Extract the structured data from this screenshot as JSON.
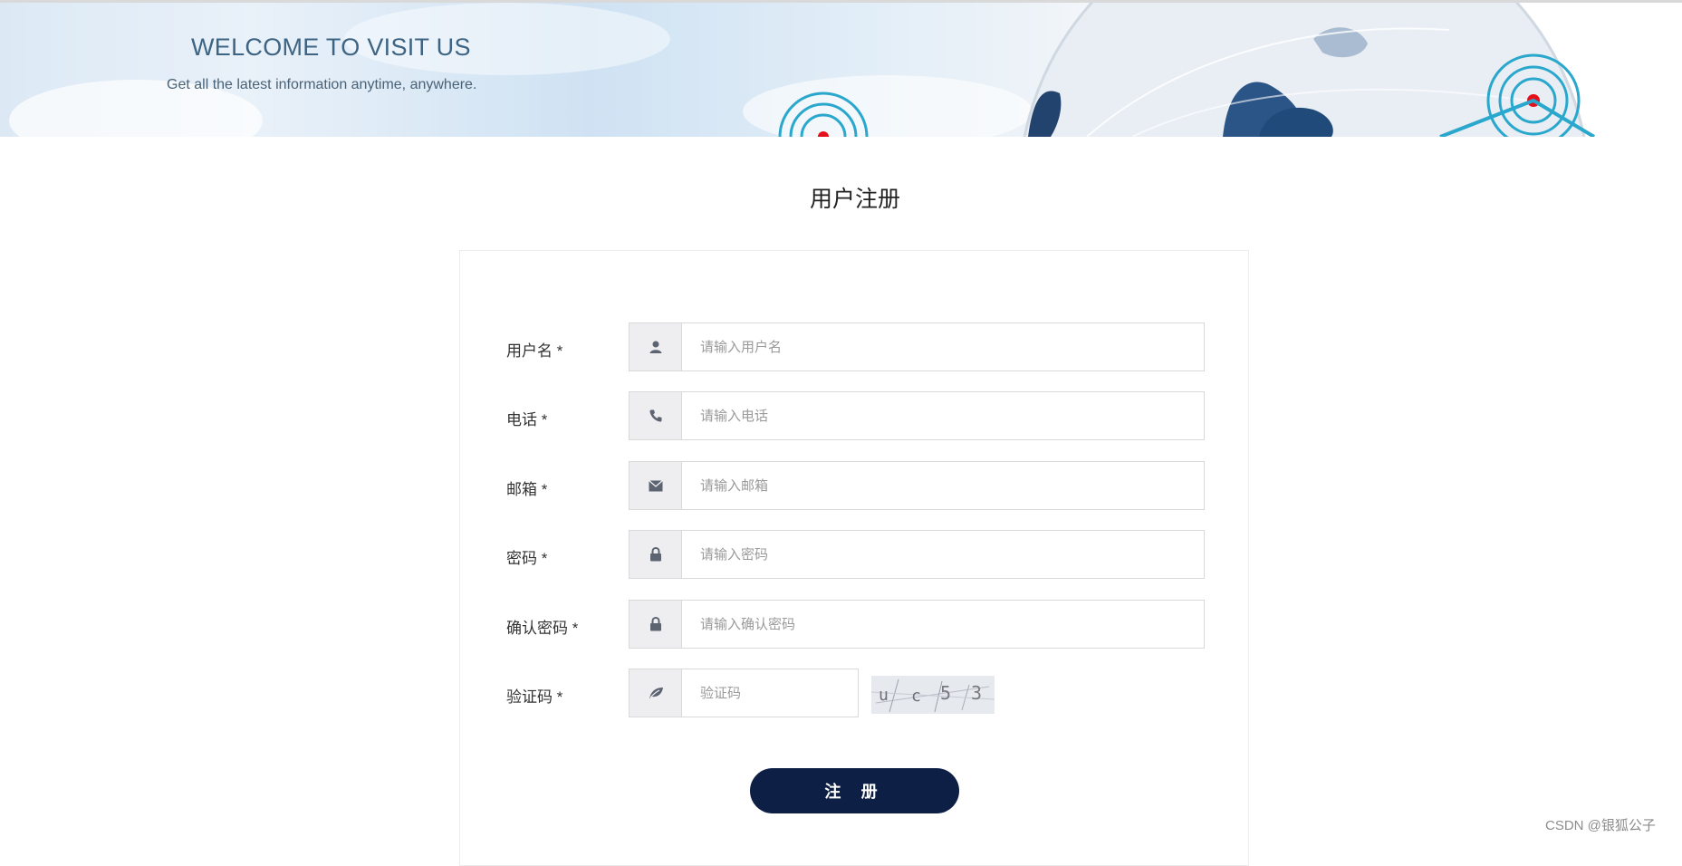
{
  "banner": {
    "title": "WELCOME TO VISIT US",
    "subtitle": "Get all the latest information anytime, anywhere."
  },
  "page_title": "用户注册",
  "form": {
    "fields": [
      {
        "label": "用户名 *",
        "placeholder": "请输入用户名",
        "icon": "user-icon"
      },
      {
        "label": "电话 *",
        "placeholder": "请输入电话",
        "icon": "phone-icon"
      },
      {
        "label": "邮箱 *",
        "placeholder": "请输入邮箱",
        "icon": "envelope-icon"
      },
      {
        "label": "密码 *",
        "placeholder": "请输入密码",
        "icon": "lock-icon"
      },
      {
        "label": "确认密码 *",
        "placeholder": "请输入确认密码",
        "icon": "lock-icon"
      },
      {
        "label": "验证码 *",
        "placeholder": "验证码",
        "icon": "leaf-icon"
      }
    ],
    "captcha_text": "uc53",
    "submit_label": "注 册"
  },
  "watermark": "CSDN @银狐公子",
  "colors": {
    "banner_title": "#3e6483",
    "button_bg": "#0d1f44",
    "addon_bg": "#eeeef1",
    "border": "#d9d9d9"
  }
}
